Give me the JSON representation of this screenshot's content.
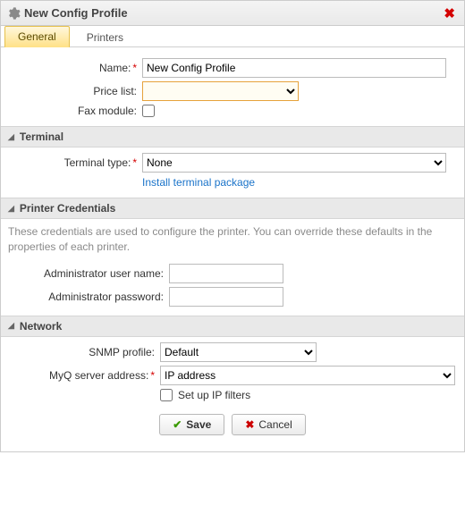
{
  "titlebar": {
    "title": "New Config Profile"
  },
  "tabs": {
    "general": "General",
    "printers": "Printers"
  },
  "general": {
    "name_label": "Name:",
    "name_value": "New Config Profile",
    "pricelist_label": "Price list:",
    "pricelist_value": "",
    "fax_label": "Fax module:"
  },
  "terminal": {
    "section_title": "Terminal",
    "type_label": "Terminal type:",
    "type_value": "None",
    "install_link": "Install terminal package"
  },
  "creds": {
    "section_title": "Printer Credentials",
    "note": "These credentials are used to configure the printer. You can override these defaults in the properties of each printer.",
    "user_label": "Administrator user name:",
    "user_value": "",
    "pass_label": "Administrator password:",
    "pass_value": ""
  },
  "network": {
    "section_title": "Network",
    "snmp_label": "SNMP profile:",
    "snmp_value": "Default",
    "server_label": "MyQ server address:",
    "server_value": "IP address",
    "ipfilter_label": "Set up IP filters"
  },
  "buttons": {
    "save": "Save",
    "cancel": "Cancel"
  }
}
